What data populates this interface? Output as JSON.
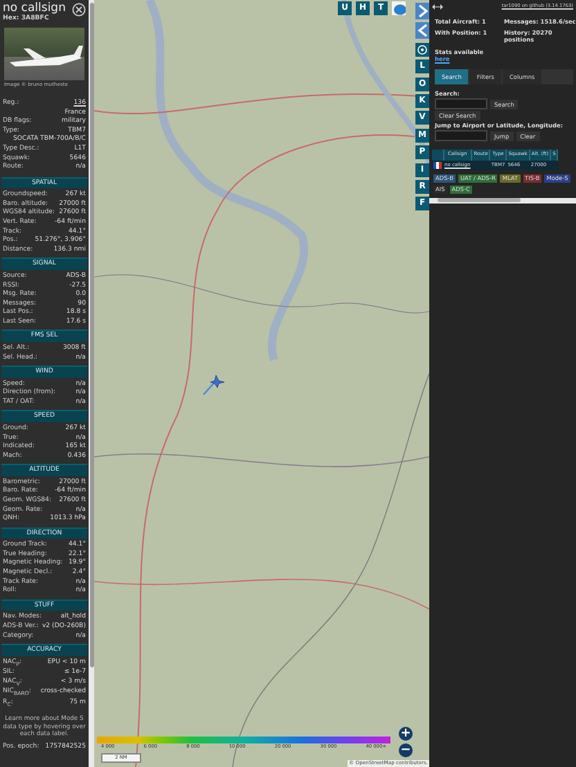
{
  "detail": {
    "callsign": "no callsign",
    "hex": "Hex: 3A8BFC",
    "photo_credit": "Image © bruno mutheste",
    "info": [
      {
        "label": "Reg.:",
        "value": "136",
        "kind": "link"
      },
      {
        "value": "France",
        "kind": "plain"
      },
      {
        "label": "DB flags:",
        "value": "military",
        "kind": "plain"
      },
      {
        "label": "Type:",
        "value": "TBM7",
        "kind": "plain"
      },
      {
        "value": "SOCATA TBM-700A/B/C",
        "kind": "plain"
      },
      {
        "label": "Type Desc.:",
        "value": "L1T",
        "kind": "plain"
      },
      {
        "label": "Squawk:",
        "value": "5646",
        "kind": "plain"
      },
      {
        "label": "Route:",
        "value": "n/a",
        "kind": "plain"
      }
    ],
    "sections": [
      {
        "title": "SPATIAL",
        "rows": [
          {
            "label": "Groundspeed:",
            "value": "267 kt"
          },
          {
            "label": "Baro. altitude:",
            "value": "27000 ft"
          },
          {
            "label": "WGS84 altitude:",
            "value": "27600 ft"
          },
          {
            "label": "Vert. Rate:",
            "value": "-64 ft/min"
          },
          {
            "label": "Track:",
            "value": "44.1°"
          },
          {
            "label": "Pos.:",
            "value": "51.276°, 3.906°"
          },
          {
            "label": "Distance:",
            "value": "136.3 nmi"
          }
        ]
      },
      {
        "title": "SIGNAL",
        "rows": [
          {
            "label": "Source:",
            "value": "ADS-B"
          },
          {
            "label": "RSSI:",
            "value": "-27.5"
          },
          {
            "label": "Msg. Rate:",
            "value": "0.0"
          },
          {
            "label": "Messages:",
            "value": "90"
          },
          {
            "label": "Last Pos.:",
            "value": "18.8 s"
          },
          {
            "label": "Last Seen:",
            "value": "17.6 s"
          }
        ]
      },
      {
        "title": "FMS SEL",
        "rows": [
          {
            "label": "Sel. Alt.:",
            "value": "3008 ft"
          },
          {
            "label": "Sel. Head.:",
            "value": "n/a"
          }
        ]
      },
      {
        "title": "WIND",
        "rows": [
          {
            "label": "Speed:",
            "value": "n/a"
          },
          {
            "label": "Direction (from):",
            "value": "n/a"
          },
          {
            "label": "TAT / OAT:",
            "value": "n/a"
          }
        ]
      },
      {
        "title": "SPEED",
        "rows": [
          {
            "label": "Ground:",
            "value": "267 kt"
          },
          {
            "label": "True:",
            "value": "n/a"
          },
          {
            "label": "Indicated:",
            "value": "165 kt"
          },
          {
            "label": "Mach:",
            "value": "0.436"
          }
        ]
      },
      {
        "title": "ALTITUDE",
        "rows": [
          {
            "label": "Barometric:",
            "value": "27000 ft"
          },
          {
            "label": "Baro. Rate:",
            "value": "-64 ft/min"
          },
          {
            "label": "Geom. WGS84:",
            "value": "27600 ft"
          },
          {
            "label": "Geom. Rate:",
            "value": "n/a"
          },
          {
            "label": "QNH:",
            "value": "1013.3 hPa"
          }
        ]
      },
      {
        "title": "DIRECTION",
        "rows": [
          {
            "label": "Ground Track:",
            "value": "44.1°"
          },
          {
            "label": "True Heading:",
            "value": "22.1°"
          },
          {
            "label": "Magnetic Heading:",
            "value": "19.9°"
          },
          {
            "label": "Magnetic Decl.:",
            "value": "2.4°"
          },
          {
            "label": "Track Rate:",
            "value": "n/a"
          },
          {
            "label": "Roll:",
            "value": "n/a"
          }
        ]
      },
      {
        "title": "STUFF",
        "rows": [
          {
            "label": "Nav. Modes:",
            "value": "alt_hold"
          },
          {
            "label": "ADS-B Ver.:",
            "value": "v2 (DO-260B)"
          },
          {
            "label": "Category:",
            "value": "n/a"
          }
        ]
      },
      {
        "title": "ACCURACY",
        "rows": [
          {
            "label": "NAC$_{P}$:",
            "value": "EPU < 10 m"
          },
          {
            "label": "SIL:",
            "value": "≤ 1e-7"
          },
          {
            "label": "NAC$_{V}$:",
            "value": "< 3 m/s"
          },
          {
            "label": "NIC$_{BARO}$:",
            "value": "cross-checked"
          },
          {
            "label": "R$_{C}$:",
            "value": "75 m"
          }
        ]
      }
    ],
    "note": "Learn more about Mode S data type by hovering over each data label.",
    "epoch": {
      "label": "Pos. epoch:",
      "value": "1757842525"
    }
  },
  "map": {
    "top_buttons": [
      "U",
      "H",
      "T"
    ],
    "side_buttons": [
      "L",
      "O",
      "K",
      "V",
      "M",
      "P",
      "I",
      "R",
      "F"
    ],
    "legend": [
      "4 000",
      "6 000",
      "8 000",
      "10 000",
      "20 000",
      "30 000",
      "40 000+"
    ],
    "scale": "2 NM",
    "zoom_in": "+",
    "zoom_out": "−",
    "attribution": "© OpenStreetMap contributors."
  },
  "panel": {
    "github_link": "tar1090 on github (3.14.1763)",
    "stats": [
      {
        "label": "Total Aircraft: 1"
      },
      {
        "label": "Messages: 1518.6/sec"
      },
      {
        "label": "With Position: 1"
      },
      {
        "label": "History: 20270 positions"
      }
    ],
    "stats_note": "Stats available",
    "stats_link": "here",
    "tabs": [
      {
        "label": "Search",
        "selected": true
      },
      {
        "label": "Filters",
        "selected": false
      },
      {
        "label": "Columns",
        "selected": false
      }
    ],
    "search_label": "Search:",
    "search_button": "Search",
    "clear_search": "Clear Search",
    "jump_label": "Jump to Airport or Latitude, Longitude:",
    "jump_button": "Jump",
    "clear_button": "Clear",
    "table": {
      "columns": [
        "Callsign",
        "Route",
        "Type",
        "Squawk",
        "Alt. (ft)",
        "S"
      ],
      "rows": [
        {
          "callsign": "no callsign",
          "type": "TBM7",
          "squawk": "5646",
          "alt": "27000"
        }
      ]
    },
    "sources": [
      {
        "label": "ADS-B",
        "color": "#2c5478"
      },
      {
        "label": "UAT / ADS-R",
        "color": "#2f6e3a"
      },
      {
        "label": "MLAT",
        "color": "#6b6a2a"
      },
      {
        "label": "TIS-B",
        "color": "#7a2c34"
      },
      {
        "label": "Mode-S",
        "color": "#2c3d8a"
      },
      {
        "label": "AIS",
        "color": "#2a2a2a"
      },
      {
        "label": "ADS-C",
        "color": "#2f6e3a"
      }
    ]
  }
}
